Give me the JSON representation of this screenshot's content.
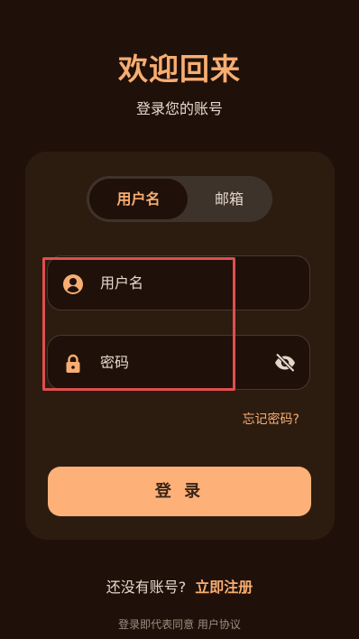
{
  "header": {
    "title": "欢迎回来",
    "subtitle": "登录您的账号"
  },
  "tabs": [
    {
      "label": "用户名",
      "active": true
    },
    {
      "label": "邮箱",
      "active": false
    }
  ],
  "fields": {
    "username": {
      "placeholder": "用户名",
      "icon": "user-icon"
    },
    "password": {
      "placeholder": "密码",
      "icon": "lock-icon",
      "toggle_icon": "eye-off-icon"
    }
  },
  "forgot_password": "忘记密码?",
  "login_button": "登 录",
  "register": {
    "question": "还没有账号?",
    "link": "立即注册"
  },
  "footer": {
    "text": "登录即代表同意 用户协议"
  },
  "colors": {
    "background": "#1f1109",
    "accent": "#f8ad72",
    "button": "#fdb179",
    "highlight_border": "#df4f4f"
  }
}
